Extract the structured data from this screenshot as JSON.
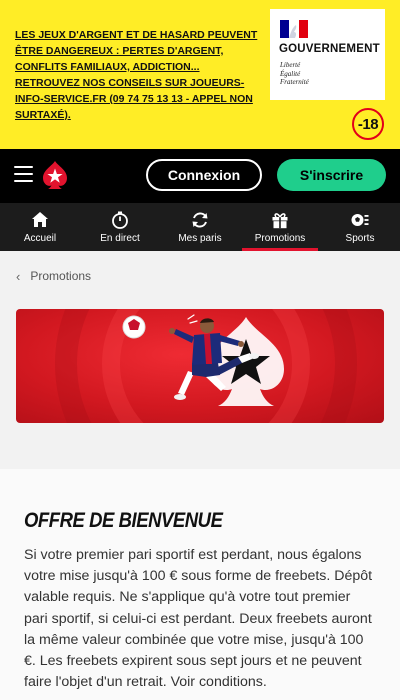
{
  "warning": {
    "text": "Les jeux d'argent et de hasard peuvent être dangereux : pertes d'argent, conflits familiaux, addiction... Retrouvez nos conseils sur joueurs-info-service.fr (09 74 75 13 13 - appel non surtaxé).",
    "gov_title": "GOUVERNEMENT",
    "gov_motto_1": "Liberté",
    "gov_motto_2": "Égalité",
    "gov_motto_3": "Fraternité",
    "age_badge": "-18"
  },
  "header": {
    "login_label": "Connexion",
    "signup_label": "S'inscrire"
  },
  "nav": {
    "items": [
      {
        "label": "Accueil",
        "icon": "home-icon"
      },
      {
        "label": "En direct",
        "icon": "stopwatch-icon"
      },
      {
        "label": "Mes paris",
        "icon": "refresh-icon"
      },
      {
        "label": "Promotions",
        "icon": "gift-icon"
      },
      {
        "label": "Sports",
        "icon": "sports-icon"
      }
    ],
    "active": "Promotions"
  },
  "breadcrumb": {
    "current": "Promotions"
  },
  "offer": {
    "title": "OFFRE DE BIENVENUE",
    "body": "Si votre premier pari sportif est perdant, nous égalons votre mise jusqu'à 100 € sous forme de freebets. Dépôt valable requis. Ne s'applique qu'à votre tout premier pari sportif, si celui-ci est perdant. Deux freebets auront la même valeur combinée que votre mise, jusqu'à 100 €. Les freebets expirent sous sept jours et ne peuvent faire l'objet d'un retrait. Voir conditions."
  },
  "colors": {
    "warning_bg": "#ffed26",
    "brand_red": "#e2132e",
    "signup_green": "#1fce8c",
    "header_bg": "#000000",
    "nav_bg": "#1c1c1c"
  }
}
